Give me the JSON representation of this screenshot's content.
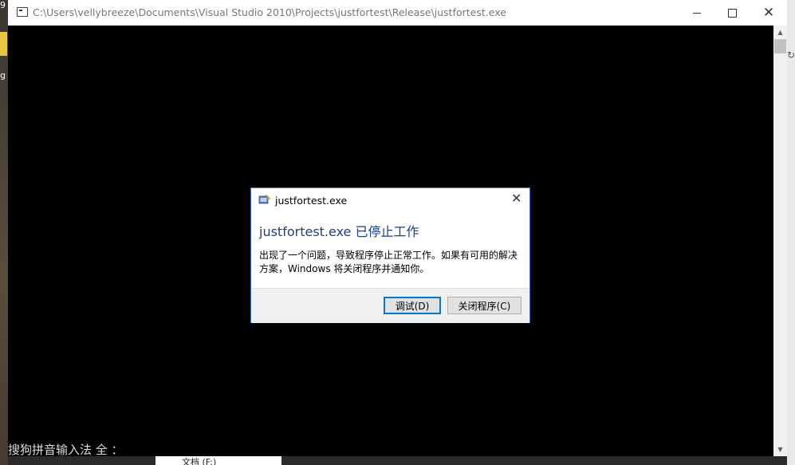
{
  "background": {
    "left_text_1": "9",
    "left_text_2": "g",
    "right_icon": "refresh-icon",
    "bottom_strip_text": "文档 (F:)"
  },
  "window": {
    "title": "C:\\Users\\vellybreeze\\Documents\\Visual Studio 2010\\Projects\\justfortest\\Release\\justfortest.exe",
    "icons": {
      "app": "console-app-icon",
      "minimize": "minimize-icon",
      "maximize": "maximize-icon",
      "close": "close-icon"
    },
    "close_glyph": "✕"
  },
  "console": {
    "ime_status": "搜狗拼音输入法 全 ："
  },
  "dialog": {
    "title": "justfortest.exe",
    "close_glyph": "✕",
    "heading": "justfortest.exe 已停止工作",
    "message": "出现了一个问题，导致程序停止正常工作。如果有可用的解决方案，Windows 将关闭程序并通知你。",
    "buttons": {
      "debug": "调试(D)",
      "close_program": "关闭程序(C)"
    }
  },
  "scrollbar": {
    "up_glyph": "▲",
    "down_glyph": "▼"
  }
}
